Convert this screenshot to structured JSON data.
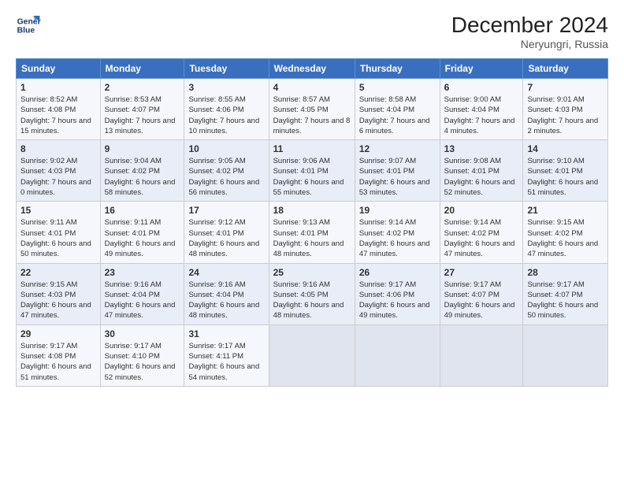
{
  "logo": {
    "line1": "General",
    "line2": "Blue"
  },
  "title": "December 2024",
  "location": "Neryungri, Russia",
  "days_of_week": [
    "Sunday",
    "Monday",
    "Tuesday",
    "Wednesday",
    "Thursday",
    "Friday",
    "Saturday"
  ],
  "weeks": [
    [
      {
        "day": 1,
        "sunrise": "8:52 AM",
        "sunset": "4:08 PM",
        "daylight": "7 hours and 15 minutes."
      },
      {
        "day": 2,
        "sunrise": "8:53 AM",
        "sunset": "4:07 PM",
        "daylight": "7 hours and 13 minutes."
      },
      {
        "day": 3,
        "sunrise": "8:55 AM",
        "sunset": "4:06 PM",
        "daylight": "7 hours and 10 minutes."
      },
      {
        "day": 4,
        "sunrise": "8:57 AM",
        "sunset": "4:05 PM",
        "daylight": "7 hours and 8 minutes."
      },
      {
        "day": 5,
        "sunrise": "8:58 AM",
        "sunset": "4:04 PM",
        "daylight": "7 hours and 6 minutes."
      },
      {
        "day": 6,
        "sunrise": "9:00 AM",
        "sunset": "4:04 PM",
        "daylight": "7 hours and 4 minutes."
      },
      {
        "day": 7,
        "sunrise": "9:01 AM",
        "sunset": "4:03 PM",
        "daylight": "7 hours and 2 minutes."
      }
    ],
    [
      {
        "day": 8,
        "sunrise": "9:02 AM",
        "sunset": "4:03 PM",
        "daylight": "7 hours and 0 minutes."
      },
      {
        "day": 9,
        "sunrise": "9:04 AM",
        "sunset": "4:02 PM",
        "daylight": "6 hours and 58 minutes."
      },
      {
        "day": 10,
        "sunrise": "9:05 AM",
        "sunset": "4:02 PM",
        "daylight": "6 hours and 56 minutes."
      },
      {
        "day": 11,
        "sunrise": "9:06 AM",
        "sunset": "4:01 PM",
        "daylight": "6 hours and 55 minutes."
      },
      {
        "day": 12,
        "sunrise": "9:07 AM",
        "sunset": "4:01 PM",
        "daylight": "6 hours and 53 minutes."
      },
      {
        "day": 13,
        "sunrise": "9:08 AM",
        "sunset": "4:01 PM",
        "daylight": "6 hours and 52 minutes."
      },
      {
        "day": 14,
        "sunrise": "9:10 AM",
        "sunset": "4:01 PM",
        "daylight": "6 hours and 51 minutes."
      }
    ],
    [
      {
        "day": 15,
        "sunrise": "9:11 AM",
        "sunset": "4:01 PM",
        "daylight": "6 hours and 50 minutes."
      },
      {
        "day": 16,
        "sunrise": "9:11 AM",
        "sunset": "4:01 PM",
        "daylight": "6 hours and 49 minutes."
      },
      {
        "day": 17,
        "sunrise": "9:12 AM",
        "sunset": "4:01 PM",
        "daylight": "6 hours and 48 minutes."
      },
      {
        "day": 18,
        "sunrise": "9:13 AM",
        "sunset": "4:01 PM",
        "daylight": "6 hours and 48 minutes."
      },
      {
        "day": 19,
        "sunrise": "9:14 AM",
        "sunset": "4:02 PM",
        "daylight": "6 hours and 47 minutes."
      },
      {
        "day": 20,
        "sunrise": "9:14 AM",
        "sunset": "4:02 PM",
        "daylight": "6 hours and 47 minutes."
      },
      {
        "day": 21,
        "sunrise": "9:15 AM",
        "sunset": "4:02 PM",
        "daylight": "6 hours and 47 minutes."
      }
    ],
    [
      {
        "day": 22,
        "sunrise": "9:15 AM",
        "sunset": "4:03 PM",
        "daylight": "6 hours and 47 minutes."
      },
      {
        "day": 23,
        "sunrise": "9:16 AM",
        "sunset": "4:04 PM",
        "daylight": "6 hours and 47 minutes."
      },
      {
        "day": 24,
        "sunrise": "9:16 AM",
        "sunset": "4:04 PM",
        "daylight": "6 hours and 48 minutes."
      },
      {
        "day": 25,
        "sunrise": "9:16 AM",
        "sunset": "4:05 PM",
        "daylight": "6 hours and 48 minutes."
      },
      {
        "day": 26,
        "sunrise": "9:17 AM",
        "sunset": "4:06 PM",
        "daylight": "6 hours and 49 minutes."
      },
      {
        "day": 27,
        "sunrise": "9:17 AM",
        "sunset": "4:07 PM",
        "daylight": "6 hours and 49 minutes."
      },
      {
        "day": 28,
        "sunrise": "9:17 AM",
        "sunset": "4:07 PM",
        "daylight": "6 hours and 50 minutes."
      }
    ],
    [
      {
        "day": 29,
        "sunrise": "9:17 AM",
        "sunset": "4:08 PM",
        "daylight": "6 hours and 51 minutes."
      },
      {
        "day": 30,
        "sunrise": "9:17 AM",
        "sunset": "4:10 PM",
        "daylight": "6 hours and 52 minutes."
      },
      {
        "day": 31,
        "sunrise": "9:17 AM",
        "sunset": "4:11 PM",
        "daylight": "6 hours and 54 minutes."
      },
      null,
      null,
      null,
      null
    ]
  ]
}
